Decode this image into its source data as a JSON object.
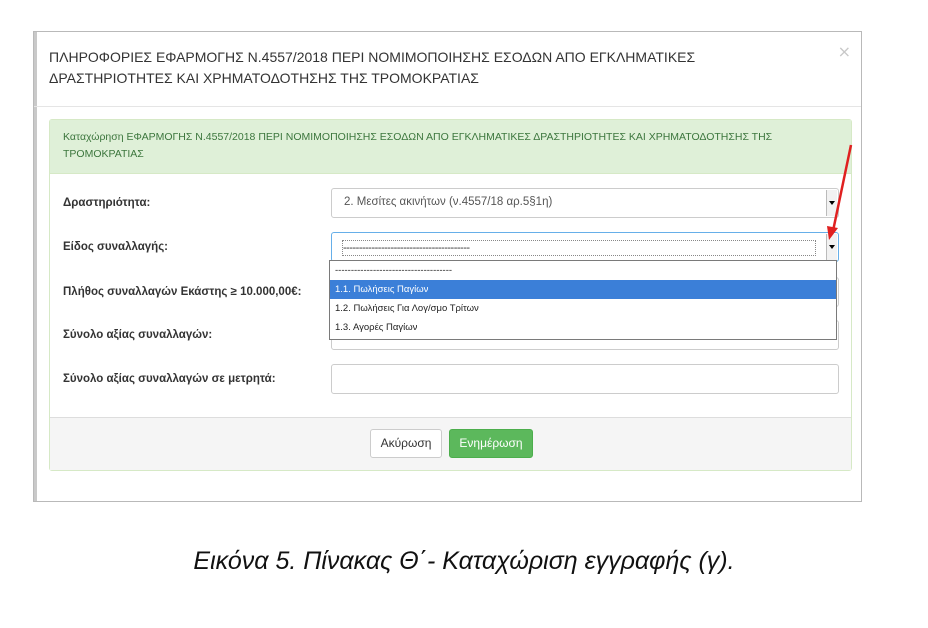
{
  "modal": {
    "title": "ΠΛΗΡΟΦΟΡΙΕΣ ΕΦΑΡΜΟΓΗΣ Ν.4557/2018 ΠΕΡΙ ΝΟΜΙΜΟΠΟΙΗΣΗΣ ΕΣΟΔΩΝ ΑΠΟ ΕΓΚΛΗΜΑΤΙΚΕΣ ΔΡΑΣΤΗΡΙΟΤΗΤΕΣ ΚΑΙ ΧΡΗΜΑΤΟΔΟΤΗΣΗΣ ΤΗΣ ΤΡΟΜΟΚΡΑΤΙΑΣ",
    "close_icon": "×"
  },
  "panel": {
    "heading": "Καταχώρηση ΕΦΑΡΜΟΓΗΣ Ν.4557/2018 ΠΕΡΙ ΝΟΜΙΜΟΠΟΙΗΣΗΣ ΕΣΟΔΩΝ ΑΠΟ ΕΓΚΛΗΜΑΤΙΚΕΣ ΔΡΑΣΤΗΡΙΟΤΗΤΕΣ ΚΑΙ ΧΡΗΜΑΤΟΔΟΤΗΣΗΣ ΤΗΣ ΤΡΟΜΟΚΡΑΤΙΑΣ"
  },
  "form": {
    "activity_label": "Δραστηριότητα:",
    "activity_value": "2. Μεσίτες ακινήτων (ν.4557/18 αρ.5§1η)",
    "transaction_type_label": "Είδος συναλλαγής:",
    "transaction_type_value": "----------------------------------------",
    "count_label": "Πλήθος συναλλαγών Εκάστης ≥ 10.000,00€:",
    "total_label": "Σύνολο αξίας συναλλαγών:",
    "cash_total_label": "Σύνολο αξίας συναλλαγών σε μετρητά:",
    "cash_total_value": ""
  },
  "dropdown": {
    "options": [
      "-------------------------------------",
      "1.1. Πωλήσεις Παγίων",
      "1.2. Πωλήσεις Για Λογ/σμο Τρίτων",
      "1.3. Αγορές Παγίων"
    ],
    "highlighted_index": 1
  },
  "footer": {
    "cancel_label": "Ακύρωση",
    "update_label": "Ενημέρωση"
  },
  "caption": "Εικόνα 5. Πίνακας Θ΄- Καταχώριση εγγραφής (γ).",
  "colors": {
    "panel_heading_bg": "#dff0d8",
    "panel_heading_text": "#3c763d",
    "update_button": "#5cb85c",
    "highlight": "#3b7fd8",
    "annotation_arrow": "#e02020"
  }
}
